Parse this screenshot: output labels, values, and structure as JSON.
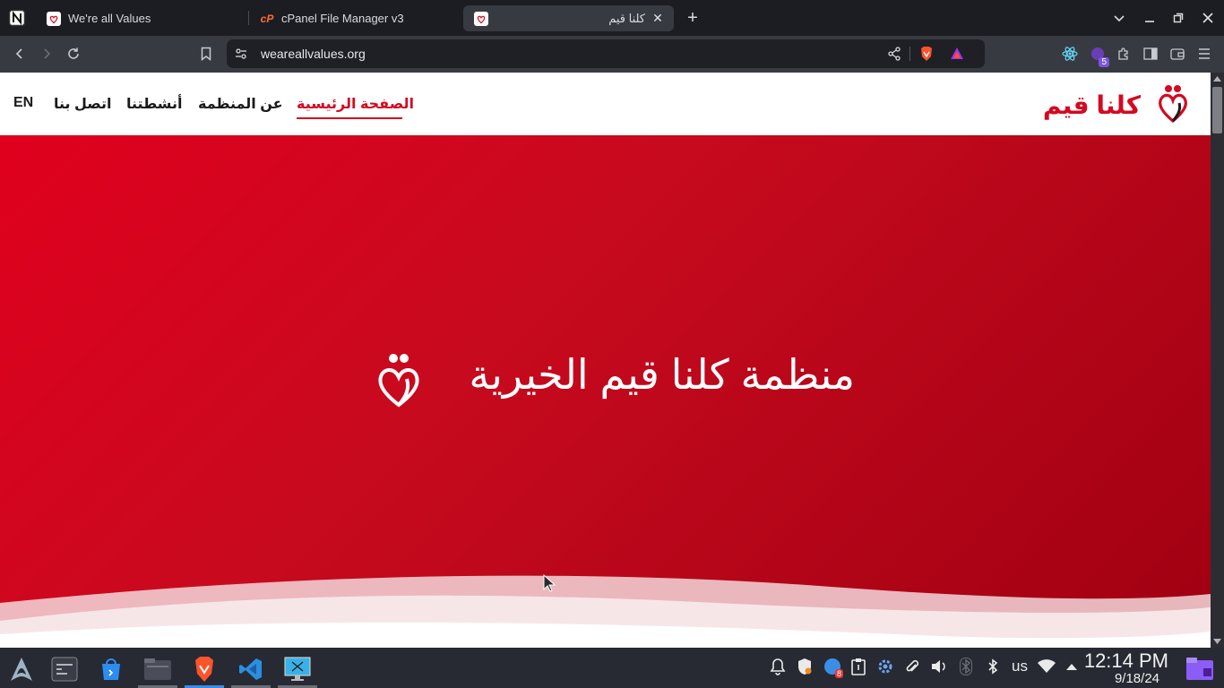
{
  "browser": {
    "tabs": [
      {
        "title": "We're all Values",
        "favicon": "site-logo-icon"
      },
      {
        "title": "cPanel File Manager v3",
        "favicon": "cpanel-icon"
      },
      {
        "title": "كلنا قيم",
        "favicon": "site-logo-icon",
        "active": true
      }
    ],
    "url": "weareallvalues.org",
    "extension_badge": "5"
  },
  "site": {
    "brand_name": "كلنا قيم",
    "nav": [
      {
        "label": "الصفحة الرئيسية",
        "active": true
      },
      {
        "label": "عن المنظمة"
      },
      {
        "label": "أنشطتنا"
      },
      {
        "label": "اتصل بنا"
      },
      {
        "label": "EN"
      }
    ],
    "hero_title": "منظمة كلنا قيم الخيرية",
    "colors": {
      "primary": "#d30a22",
      "hero_dark": "#a00012"
    }
  },
  "taskbar": {
    "apps": [
      "arch-launcher-icon",
      "terminal-icon",
      "store-icon",
      "files-icon",
      "brave-icon",
      "vscode-icon",
      "remote-desktop-icon"
    ],
    "keyboard_layout": "us",
    "notification_badge": "8",
    "time": "12:14 PM",
    "date": "9/18/24"
  }
}
